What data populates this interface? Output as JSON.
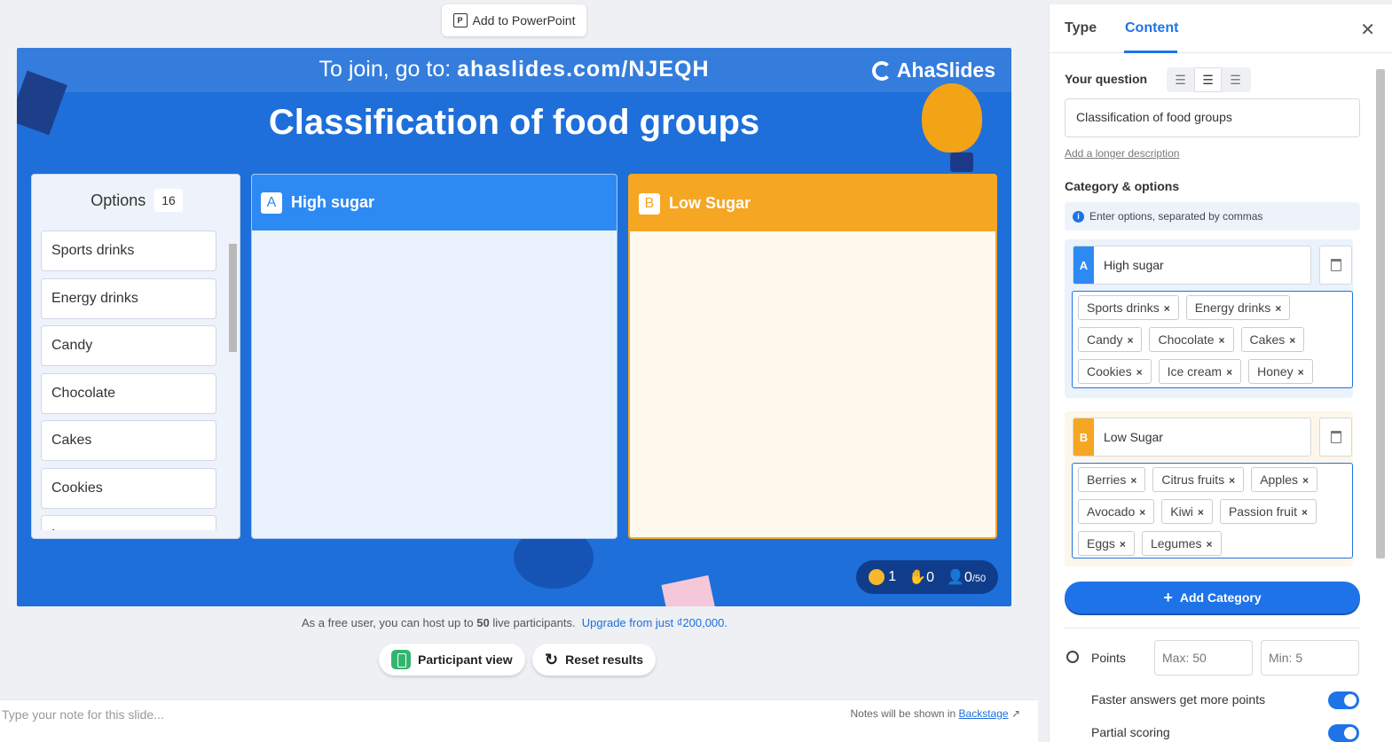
{
  "toolbar": {
    "ppt_label": "Add to PowerPoint"
  },
  "slide": {
    "join_prefix": "To join, go to: ",
    "join_url": "ahaslides.com/NJEQH",
    "brand": "AhaSlides",
    "title": "Classification of food groups",
    "options_label": "Options",
    "options_count": "16",
    "options": [
      "Sports drinks",
      "Energy drinks",
      "Candy",
      "Chocolate",
      "Cakes",
      "Cookies",
      "Ice cream"
    ],
    "categories": [
      {
        "letter": "A",
        "name": "High sugar",
        "color": "#2e8af3"
      },
      {
        "letter": "B",
        "name": "Low Sugar",
        "color": "#f5a623"
      }
    ],
    "stats": {
      "reactions": "1",
      "hands": "0",
      "participants": "0",
      "participants_max": "/50"
    }
  },
  "footer": {
    "free_text_a": "As a free user, you can host up to ",
    "free_limit": "50",
    "free_text_b": " live participants.",
    "upgrade_link": "Upgrade from just ₫200,000.",
    "participant_view": "Participant view",
    "reset_results": "Reset results",
    "notes_placeholder": "Type your note for this slide...",
    "notes_hint": "Notes will be shown in ",
    "notes_link": "Backstage"
  },
  "panel": {
    "tabs": [
      "Type",
      "Content"
    ],
    "active_tab": "Content",
    "question_label": "Your question",
    "question_value": "Classification of food groups",
    "longer_desc": "Add a longer description",
    "cat_label": "Category & options",
    "info": "Enter options, separated by commas",
    "cat_a": {
      "letter": "A",
      "name": "High sugar",
      "tags": [
        "Sports drinks",
        "Energy drinks",
        "Candy",
        "Chocolate",
        "Cakes",
        "Cookies",
        "Ice cream",
        "Honey"
      ]
    },
    "cat_b": {
      "letter": "B",
      "name": "Low Sugar",
      "tags": [
        "Berries",
        "Citrus fruits",
        "Apples",
        "Avocado",
        "Kiwi",
        "Passion fruit",
        "Eggs",
        "Legumes"
      ]
    },
    "add_category": "Add Category",
    "points_label": "Points",
    "points_max": "Max: 50",
    "points_min": "Min:  5",
    "faster_label": "Faster answers get more points",
    "partial_label": "Partial scoring"
  },
  "colors": {
    "accent": "#1e73e8",
    "slide_bg": "#1e6fd9",
    "cat_a": "#2e8af3",
    "cat_b": "#f5a623"
  }
}
